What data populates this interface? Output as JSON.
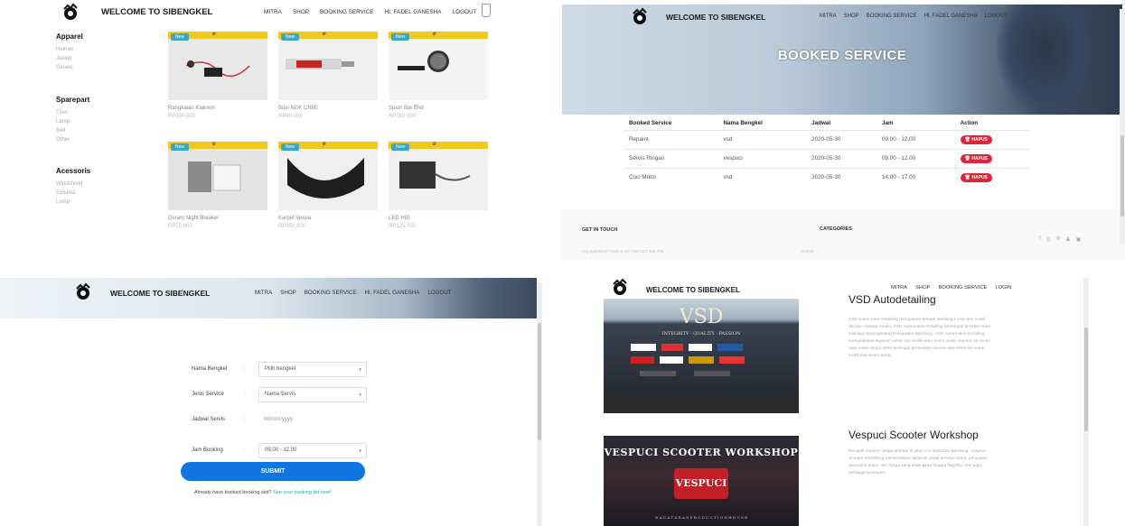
{
  "brand_title": "WELCOME TO SIBENGKEL",
  "panel_shop": {
    "nav": [
      "MITRA",
      "SHOP",
      "BOOKING SERVICE",
      "HI, FADEL GANESHA",
      "LOGOUT"
    ],
    "categories": [
      {
        "title": "Apparel",
        "items": [
          "Helmet",
          "Jacket",
          "Gloves"
        ]
      },
      {
        "title": "Sparepart",
        "items": [
          "Tires",
          "Lamp",
          "Belt",
          "Other"
        ]
      },
      {
        "title": "Acessoris",
        "items": [
          "Windshield",
          "Exhaust",
          "Lamp"
        ]
      }
    ],
    "badge": "New",
    "products": [
      {
        "name": "Rangkaian Klakson",
        "price": "RP200,000"
      },
      {
        "name": "Busi NGK CR8E",
        "price": "RP40,000"
      },
      {
        "name": "Spion Bar End",
        "price": "RP150,000"
      },
      {
        "name": "Osram Night Breaker",
        "price": "RP75,000"
      },
      {
        "name": "Karpet Vespa",
        "price": "RP350,000"
      },
      {
        "name": "LED HID",
        "price": "RP125,000"
      }
    ]
  },
  "panel_booked": {
    "nav": [
      "MITRA",
      "SHOP",
      "BOOKING SERVICE",
      "HI, FADEL GANESHA",
      "LOGOUT"
    ],
    "hero_title": "BOOKED SERVICE",
    "columns": [
      "Booked Service",
      "Nama Bengkel",
      "Jadwal",
      "Jam",
      "Action"
    ],
    "rows": [
      [
        "Repaint",
        "vsd",
        "2020-05-30",
        "09.00 - 12.00"
      ],
      [
        "Servis Ringan",
        "vespuci",
        "2020-05-30",
        "09.00 - 12.00"
      ],
      [
        "Cuci Motor",
        "vsd",
        "2020-05-30",
        "14.00 - 17.00"
      ]
    ],
    "action_label": "HAPUS",
    "footer_get_in_touch": "GET IN TOUCH",
    "footer_categories": "CATEGORIES",
    "footer_contact_text": "Any questions? Call us on (+62) 812 345 702",
    "footer_cat_item": "Helmet"
  },
  "panel_form": {
    "nav": [
      "MITRA",
      "SHOP",
      "BOOKING SERVICE",
      "HI, FADEL GANESHA",
      "LOGOUT"
    ],
    "labels": [
      "Nama Bengkel",
      "Jenis Service",
      "Jadwal Servis",
      "Jam Booking"
    ],
    "colon": ":",
    "values": [
      "Pilih bengkel",
      "Nama Servis",
      "dd/mm/yyyy",
      "09.00 - 12.00"
    ],
    "submit": "SUBMIT",
    "already_text": "Already have booked booking slot?",
    "already_link": "See your booking list now!"
  },
  "panel_mitra": {
    "nav": [
      "MITRA",
      "SHOP",
      "BOOKING SERVICE",
      "LOGIN"
    ],
    "shops": [
      {
        "title": "VSD Autodetailing",
        "desc": "VSD Automotive Detailing merupakan tempat detailing motor dan mobil dengan konsep studio. VSD Automotive Detailing bertempat di Ruko Akira Cileunyi, Bojongsoang Kabupaten Bandung. VSD Automotive Detailing menyediakan layanan untuk cuci mobil atau motor anda, repaint cat mobil atau motor anda, serta berbagai perawatan interior dan eksterior untuk mobil dan motor anda.",
        "sign": "VSD",
        "sign_sub": "INTEGRITY · QUALITY · PASSION"
      },
      {
        "title": "Vespuci Scooter Workshop",
        "desc": "Bengkel modern vespa terletak di jalan A.H Nasution Bandung. Vespuci Scooter Workshop menyediakan layanan untuk service motor, penjualan aksesoris motor dan harga yang terjangkau hingga flagship, dan juga berbagai sparepart.",
        "sign": "VESPUCI SCOOTER WORKSHOP",
        "sign_sub": "VESPUCI",
        "sign_footer": "N A G A T A R A N   P R O D U C T I O N   H O U S E"
      }
    ]
  }
}
